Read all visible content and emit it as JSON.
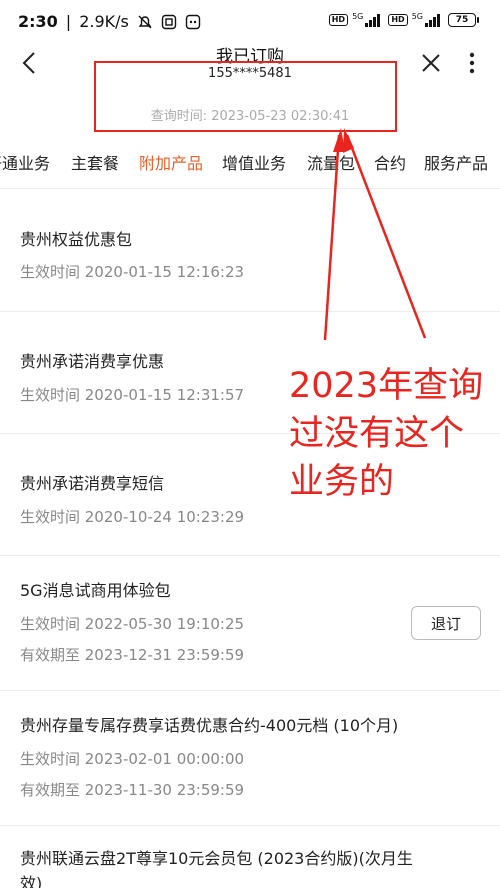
{
  "status_bar": {
    "time": "2:30",
    "speed": "2.9K/s",
    "battery": "75",
    "network_1": "5G",
    "network_2": "5G",
    "hd_1": "HD",
    "hd_2": "HD"
  },
  "header": {
    "title": "我已订购",
    "phone": "155****5481",
    "query_time": "查询时间: 2023-05-23 02:30:41"
  },
  "tabs": [
    {
      "label": "开通业务"
    },
    {
      "label": "主套餐"
    },
    {
      "label": "附加产品"
    },
    {
      "label": "增值业务"
    },
    {
      "label": "流量包"
    },
    {
      "label": "合约"
    },
    {
      "label": "服务产品"
    }
  ],
  "items": [
    {
      "title": "贵州权益优惠包",
      "line1": "生效时间 2020-01-15 12:16:23"
    },
    {
      "title": "贵州承诺消费享优惠",
      "line1": "生效时间 2020-01-15 12:31:57"
    },
    {
      "title": "贵州承诺消费享短信",
      "line1": "生效时间 2020-10-24 10:23:29"
    },
    {
      "title": "5G消息试商用体验包",
      "line1": "生效时间 2022-05-30 19:10:25",
      "line2": "有效期至 2023-12-31 23:59:59",
      "button": "退订"
    },
    {
      "title": "贵州存量专属存费享话费优惠合约-400元档 (10个月)",
      "line1": "生效时间 2023-02-01 00:00:00",
      "line2": "有效期至 2023-11-30 23:59:59"
    },
    {
      "title": "贵州联通云盘2T尊享10元会员包 (2023合约版)(次月生",
      "title2": "效)"
    }
  ],
  "annotation": {
    "line1": "2023年查询",
    "line2": "过没有这个",
    "line3": "业务的",
    "color": "#e8251f"
  },
  "colors": {
    "active_tab": "#e8622c",
    "muted_text": "#888888",
    "annotation_red": "#e8251f"
  }
}
